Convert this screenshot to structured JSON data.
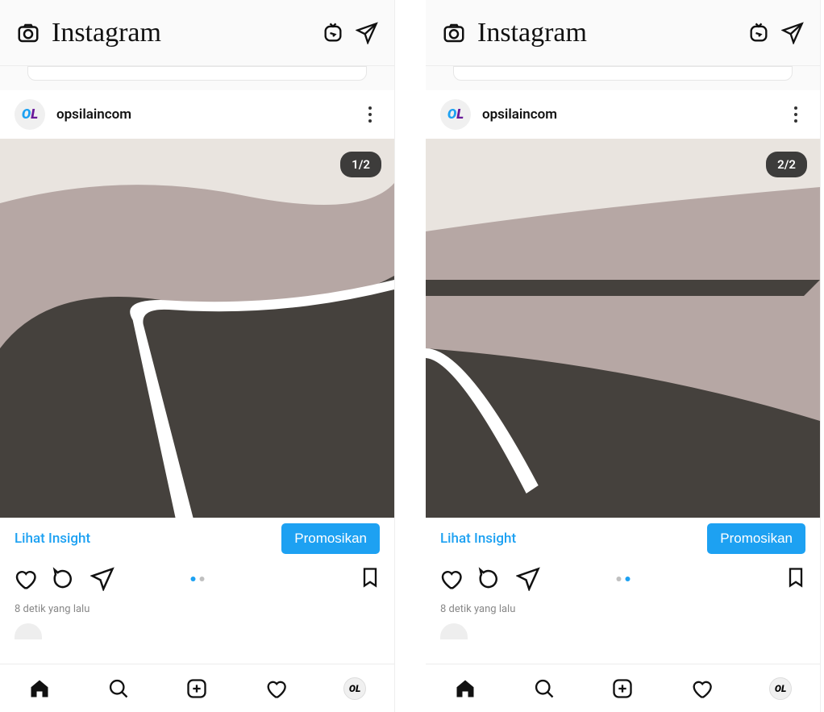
{
  "screens": [
    {
      "app_name": "Instagram",
      "post": {
        "username": "opsilaincom",
        "counter": "1/2",
        "insight_link": "Lihat Insight",
        "promote_label": "Promosikan",
        "timestamp": "8 detik yang lalu",
        "active_dot": 0
      }
    },
    {
      "app_name": "Instagram",
      "post": {
        "username": "opsilaincom",
        "counter": "2/2",
        "insight_link": "Lihat Insight",
        "promote_label": "Promosikan",
        "timestamp": "8 detik yang lalu",
        "active_dot": 1
      }
    }
  ],
  "colors": {
    "accent": "#1da1f2",
    "pill_bg": "rgba(30,30,30,0.85)"
  }
}
